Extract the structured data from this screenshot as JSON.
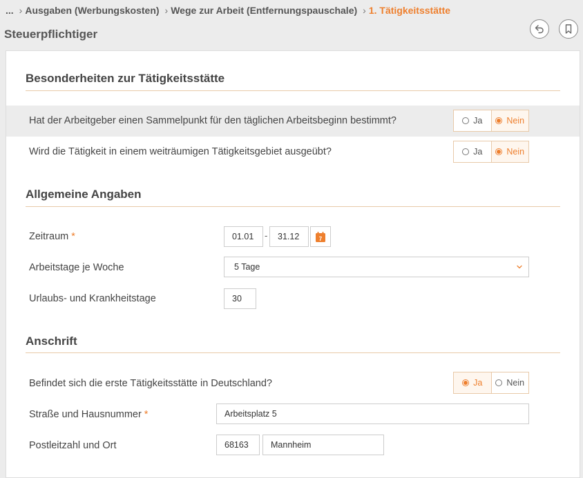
{
  "breadcrumb": {
    "items": [
      {
        "label": "...",
        "active": false
      },
      {
        "label": "Ausgaben (Werbungskosten)",
        "active": false
      },
      {
        "label": "Wege zur Arbeit (Entfernungspauschale)",
        "active": false
      },
      {
        "label": "1. Tätigkeitsstätte",
        "active": true
      }
    ]
  },
  "header": {
    "title": "Steuerpflichtiger",
    "back_icon": "undo-icon",
    "bookmark_icon": "bookmark-icon"
  },
  "colors": {
    "accent": "#ee7f2d",
    "section_line": "#e8c9a8",
    "highlight_row": "#ececec"
  },
  "sections": {
    "besonderheiten": {
      "title": "Besonderheiten zur Tätigkeitsstätte",
      "q1": {
        "label": "Hat der Arbeitgeber einen Sammelpunkt für den täglichen Arbeitsbeginn bestimmt?",
        "yes": "Ja",
        "no": "Nein",
        "selected": "Nein"
      },
      "q2": {
        "label": "Wird die Tätigkeit in einem weiträumigen Tätigkeitsgebiet ausgeübt?",
        "yes": "Ja",
        "no": "Nein",
        "selected": "Nein"
      }
    },
    "allgemein": {
      "title": "Allgemeine Angaben",
      "zeitraum": {
        "label": "Zeitraum",
        "required": "*",
        "from": "01.01",
        "separator": "-",
        "to": "31.12",
        "calendar_icon": "calendar-icon",
        "calendar_day": "7"
      },
      "arbeitstage": {
        "label": "Arbeitstage je Woche",
        "value": "5 Tage"
      },
      "urlaub": {
        "label": "Urlaubs- und Krankheitstage",
        "value": "30"
      }
    },
    "anschrift": {
      "title": "Anschrift",
      "deutschland": {
        "label": "Befindet sich die erste Tätigkeitsstätte in Deutschland?",
        "yes": "Ja",
        "no": "Nein",
        "selected": "Ja"
      },
      "strasse": {
        "label": "Straße und Hausnummer",
        "required": "*",
        "value": "Arbeitsplatz 5"
      },
      "plz_ort": {
        "label": "Postleitzahl und Ort",
        "plz": "68163",
        "ort": "Mannheim"
      }
    }
  }
}
